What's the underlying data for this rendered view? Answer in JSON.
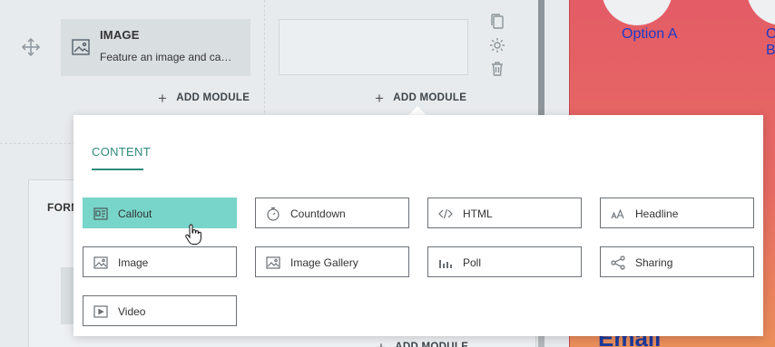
{
  "canvas": {
    "module_card": {
      "title": "IMAGE",
      "description": "Feature an image and caption"
    },
    "add_module_label": "ADD MODULE",
    "form_label": "FORM"
  },
  "preview": {
    "option_a": "Option A",
    "option_b": "Option B",
    "email_text": "Email"
  },
  "picker": {
    "tab": "CONTENT",
    "active_item": "Callout",
    "items": [
      {
        "label": "Callout",
        "icon": "callout-icon"
      },
      {
        "label": "Countdown",
        "icon": "stopwatch-icon"
      },
      {
        "label": "HTML",
        "icon": "code-icon"
      },
      {
        "label": "Headline",
        "icon": "text-size-icon"
      },
      {
        "label": "Image",
        "icon": "image-icon"
      },
      {
        "label": "Image Gallery",
        "icon": "gallery-icon"
      },
      {
        "label": "Poll",
        "icon": "bar-chart-icon"
      },
      {
        "label": "Sharing",
        "icon": "share-icon"
      },
      {
        "label": "Video",
        "icon": "video-icon"
      }
    ]
  },
  "colors": {
    "accent": "#2f8b7c",
    "active_tile": "#78d5c9",
    "preview_bg_top": "#e45c66",
    "preview_text": "#1a3cc9"
  }
}
